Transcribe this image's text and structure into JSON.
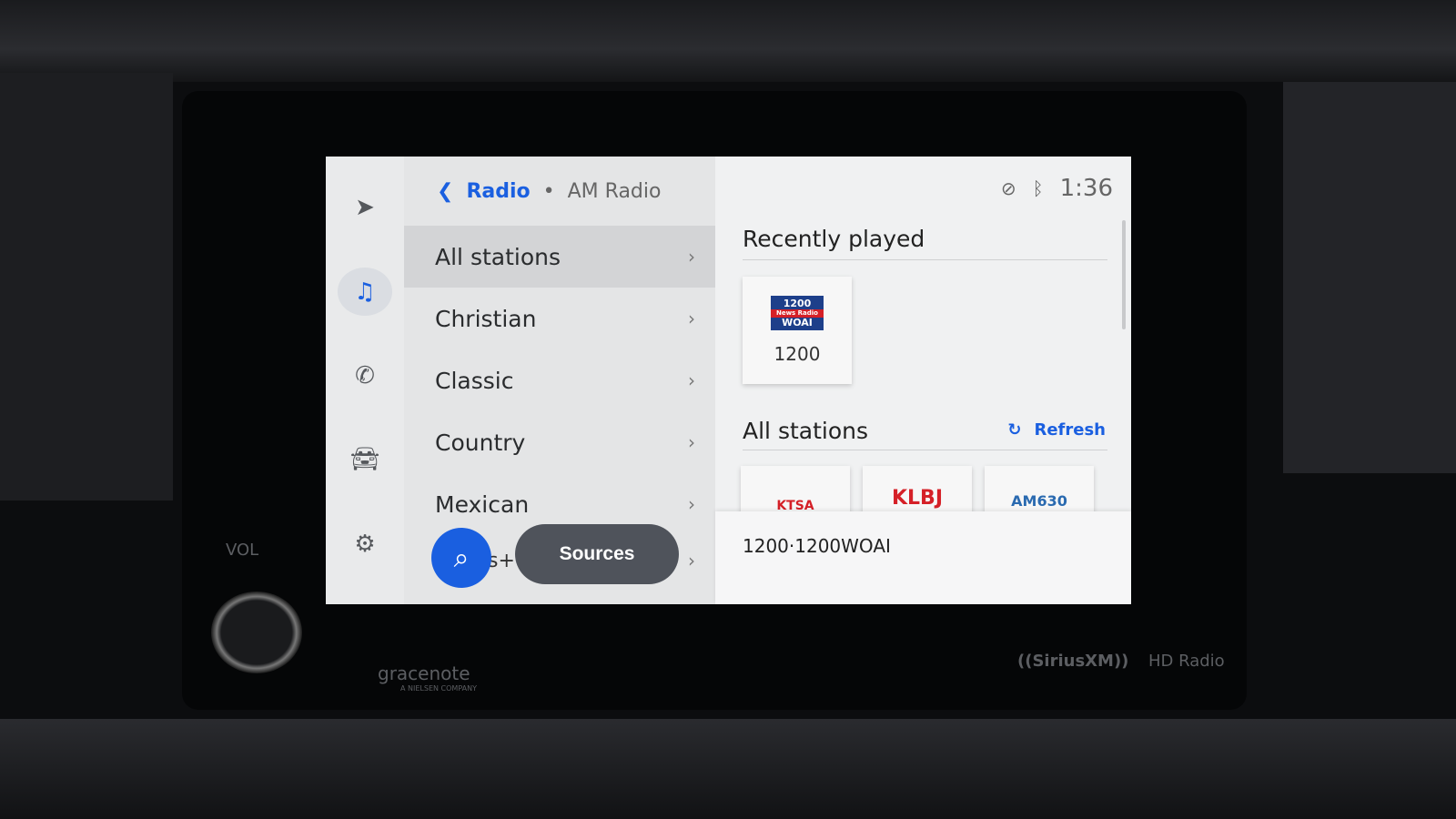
{
  "breadcrumb": {
    "back_icon": "chevron-left-icon",
    "parent": "Radio",
    "separator": "•",
    "current": "AM Radio"
  },
  "rail": [
    {
      "icon": "navigation-arrow-icon"
    },
    {
      "icon": "music-note-icon",
      "active": true
    },
    {
      "icon": "phone-icon"
    },
    {
      "icon": "car-icon"
    },
    {
      "icon": "gear-icon"
    }
  ],
  "categories": [
    {
      "label": "All stations",
      "selected": true
    },
    {
      "label": "Christian"
    },
    {
      "label": "Classic"
    },
    {
      "label": "Country"
    },
    {
      "label": "Mexican"
    }
  ],
  "partial_item": "s+",
  "buttons": {
    "search_icon": "search-icon",
    "sources": "Sources"
  },
  "status": {
    "icons": [
      "mic-off-icon",
      "bluetooth-icon"
    ],
    "time": "1:36"
  },
  "recently_played": {
    "title": "Recently played",
    "stations": [
      {
        "logo_top": "1200",
        "logo_mid": "News Radio",
        "logo_bottom": "WOAI",
        "label": "1200"
      }
    ]
  },
  "all_stations": {
    "title": "All stations",
    "refresh": "Refresh",
    "stations": [
      {
        "logo": "KTSA"
      },
      {
        "logo": "KLBJ"
      },
      {
        "logo": "AM630"
      }
    ]
  },
  "now_playing": "1200·1200WOAI",
  "bezel": {
    "vol": "VOL",
    "gracenote": "gracenote",
    "gracenote_sub": "A NIELSEN COMPANY",
    "siriusxm": "((SiriusXM))",
    "hd": "HD Radio"
  },
  "colors": {
    "accent": "#1a5fe0",
    "sources_button": "#4f535b"
  }
}
